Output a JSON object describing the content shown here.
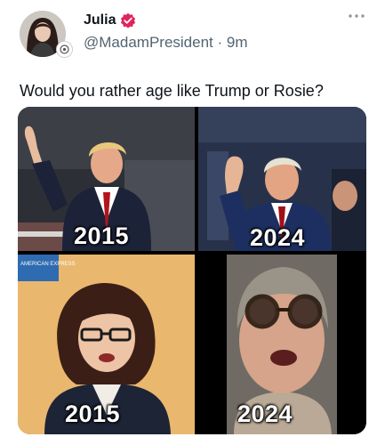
{
  "author": {
    "display_name": "Julia",
    "handle_line": "@MadamPresident · 9m"
  },
  "tweet": {
    "text": "Would you rather age like Trump or Rosie?"
  },
  "media": {
    "panels": [
      {
        "year": "2015"
      },
      {
        "year": "2024"
      },
      {
        "year": "2015",
        "sign_text": "AMERICAN EXPRESS"
      },
      {
        "year": "2024"
      }
    ]
  },
  "colors": {
    "verified_badge": "#e0245e",
    "handle_gray": "#536471",
    "text_dark": "#0f1419"
  },
  "icons": {
    "verified": "verified-badge-icon",
    "more": "more-options-icon",
    "avatar_badge": "account-badge-icon"
  }
}
